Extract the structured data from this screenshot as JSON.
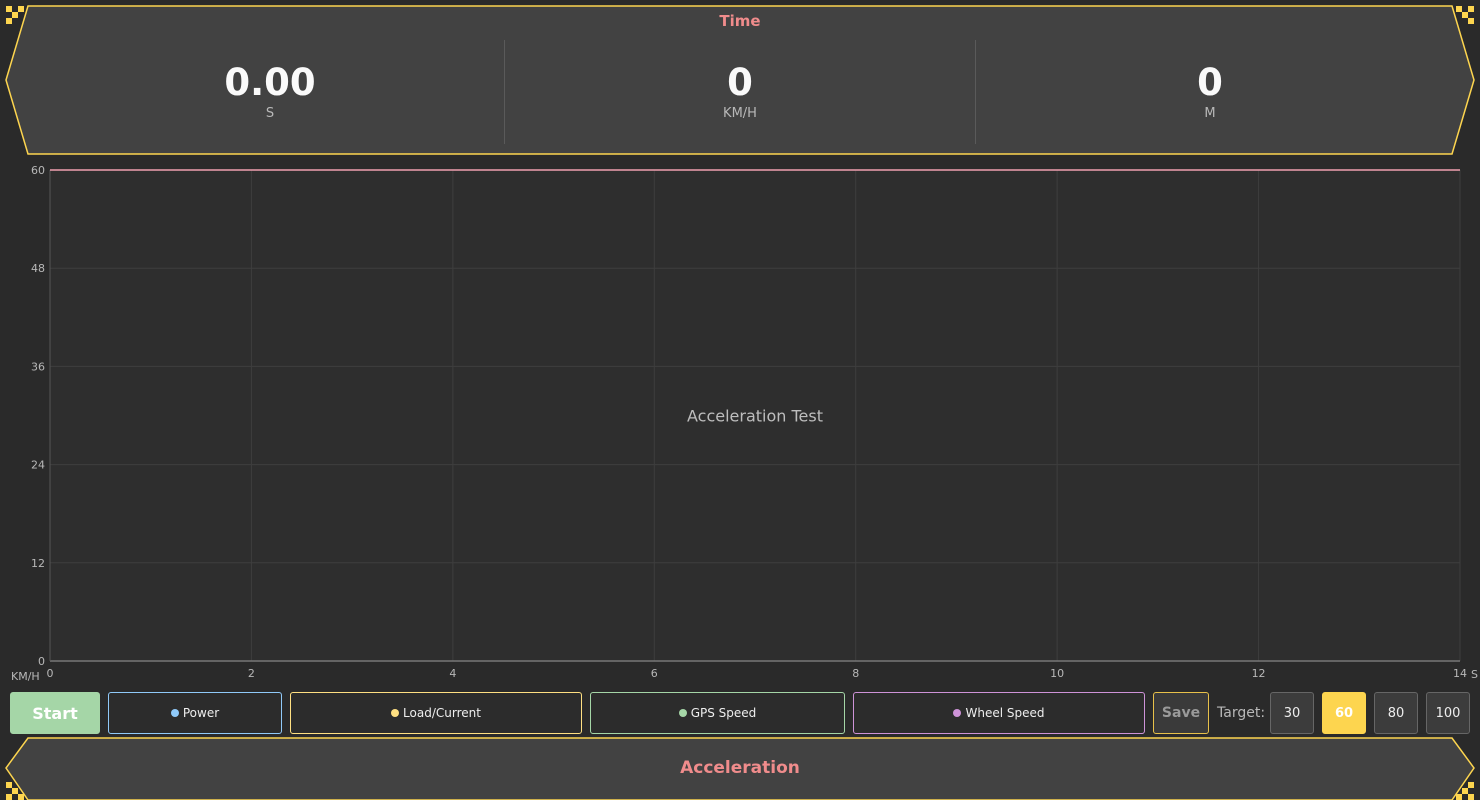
{
  "header": {
    "title": "Time",
    "stats": [
      {
        "value": "0.00",
        "unit": "S"
      },
      {
        "value": "0",
        "unit": "KM/H"
      },
      {
        "value": "0",
        "unit": "M"
      }
    ]
  },
  "chart_data": {
    "type": "line",
    "title": "Acceleration Test",
    "xlabel": "S",
    "ylabel": "KM/H",
    "xlim": [
      0,
      14
    ],
    "ylim": [
      0,
      60
    ],
    "x_ticks": [
      "0",
      "2",
      "4",
      "6",
      "8",
      "10",
      "12",
      "14"
    ],
    "y_ticks": [
      "0",
      "12",
      "24",
      "36",
      "48",
      "60"
    ],
    "target_line": 60,
    "grid": true,
    "series": []
  },
  "controls": {
    "start_label": "Start",
    "legend": [
      {
        "label": "Power",
        "color": "#90caf9"
      },
      {
        "label": "Load/Current",
        "color": "#ffe082"
      },
      {
        "label": "GPS Speed",
        "color": "#a5d6a7"
      },
      {
        "label": "Wheel Speed",
        "color": "#ce93d8"
      }
    ],
    "save_label": "Save",
    "target_label": "Target:",
    "targets": [
      "30",
      "60",
      "80",
      "100"
    ],
    "active_target": "60"
  },
  "footer": {
    "title": "Acceleration"
  },
  "colors": {
    "accent": "#fdd54f",
    "title": "#f08c8c",
    "panel": "#424242",
    "background": "#2a2a2a"
  }
}
